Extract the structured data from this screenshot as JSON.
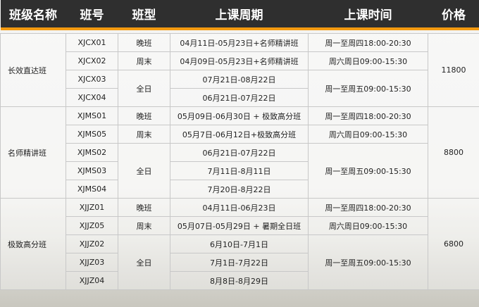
{
  "headers": [
    "班级名称",
    "班号",
    "班型",
    "上课周期",
    "上课时间",
    "价格"
  ],
  "groups": [
    {
      "name": "长效直达班",
      "price": "11800",
      "rows": [
        {
          "code": "XJCX01",
          "type": "晚班",
          "period": "04月11日-05月23日+名师精讲班",
          "time": "周一至周四18:00-20:30"
        },
        {
          "code": "XJCX02",
          "type": "周末",
          "period": "04月09日-05月23日+名师精讲班",
          "time": "周六周日09:00-15:30"
        },
        {
          "code": "XJCX03",
          "type": "全日",
          "period": "07月21日-08月22日",
          "time": "周一至周五09:00-15:30"
        },
        {
          "code": "XJCX04",
          "type": "",
          "period": "06月21日-07月22日",
          "time": ""
        }
      ]
    },
    {
      "name": "名师精讲班",
      "price": "8800",
      "rows": [
        {
          "code": "XJMS01",
          "type": "晚班",
          "period": "05月09日-06月30日 + 极致高分班",
          "time": "周一至周四18:00-20:30"
        },
        {
          "code": "XJMS05",
          "type": "周末",
          "period": "05月7日-06月12日+极致高分班",
          "time": "周六周日09:00-15:30"
        },
        {
          "code": "XJMS02",
          "type": "全日",
          "period": "06月21日-07月22日",
          "time": "周一至周五09:00-15:30"
        },
        {
          "code": "XJMS03",
          "type": "",
          "period": "7月11日-8月11日",
          "time": ""
        },
        {
          "code": "XJMS04",
          "type": "",
          "period": "7月20日-8月22日",
          "time": ""
        }
      ]
    },
    {
      "name": "极致高分班",
      "price": "6800",
      "rows": [
        {
          "code": "XJJZ01",
          "type": "晚班",
          "period": "04月11日-06月23日",
          "time": "周一至周四18:00-20:30"
        },
        {
          "code": "XJJZ05",
          "type": "周末",
          "period": "05月07日-05月29日 + 暑期全日班",
          "time": "周六周日09:00-15:30"
        },
        {
          "code": "XJJZ02",
          "type": "全日",
          "period": "6月10日-7月1日",
          "time": "周一至周五09:00-15:30"
        },
        {
          "code": "XJJZ03",
          "type": "",
          "period": "7月1日-7月22日",
          "time": ""
        },
        {
          "code": "XJJZ04",
          "type": "",
          "period": "8月8日-8月29日",
          "time": ""
        }
      ]
    }
  ],
  "colors": {
    "header_bg": "#2f2f2f",
    "header_accent": "#f39a10",
    "header_text": "#ffffff"
  }
}
